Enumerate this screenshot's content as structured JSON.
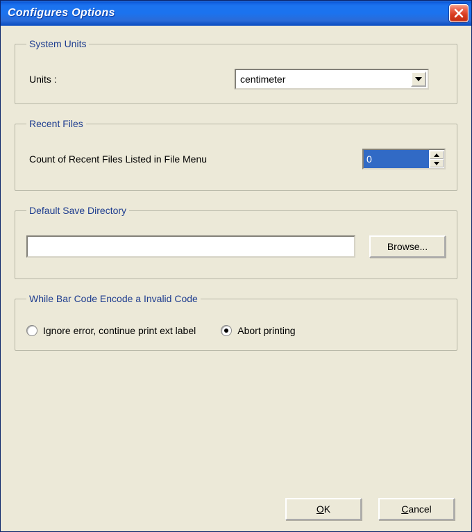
{
  "title": "Configures Options",
  "groups": {
    "systemUnits": {
      "legend": "System Units",
      "label": "Units :",
      "value": "centimeter"
    },
    "recentFiles": {
      "legend": "Recent Files",
      "label": "Count of Recent Files Listed in File Menu",
      "value": "0"
    },
    "defaultSaveDir": {
      "legend": "Default Save Directory",
      "path": "",
      "browseLabel": "Browse..."
    },
    "invalidCode": {
      "legend": "While Bar Code Encode a Invalid Code",
      "options": [
        {
          "label": "Ignore error, continue print ext label",
          "selected": false
        },
        {
          "label": "Abort printing",
          "selected": true
        }
      ]
    }
  },
  "buttons": {
    "ok": "OK",
    "cancel": "Cancel"
  }
}
